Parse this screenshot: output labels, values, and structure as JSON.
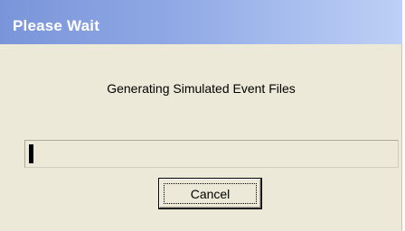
{
  "window": {
    "title": "Please Wait",
    "titlebar_gradient": [
      "#7a95d9",
      "#bdd0f5"
    ],
    "background": "#ece9d8"
  },
  "message": "Generating Simulated Event Files",
  "progress": {
    "fraction": 0.012
  },
  "buttons": {
    "cancel_label": "Cancel"
  }
}
